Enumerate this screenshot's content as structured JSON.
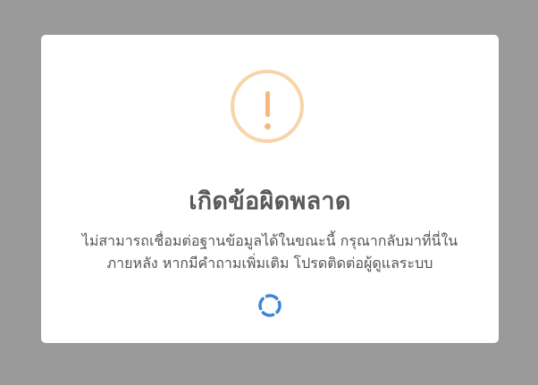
{
  "dialog": {
    "icon": "warning-icon",
    "title": "เกิดข้อผิดพลาด",
    "message_line1": "ไม่สามารถเชื่อมต่อฐานข้อมูลได้ในขณะนี้ กรุณากลับมาที่นี่ใน",
    "message_line2": "ภายหลัง หากมีคำถามเพิ่มเติม โปรดติดต่อผู้ดูแลระบบ",
    "spinner": "loading-spinner-icon"
  },
  "colors": {
    "backdrop": "#9a9a9a",
    "warning_ring": "#f8d4a8",
    "warning_mark": "#f6b97a",
    "spinner": "#3b86d6",
    "title": "#595959",
    "text": "#545454"
  }
}
